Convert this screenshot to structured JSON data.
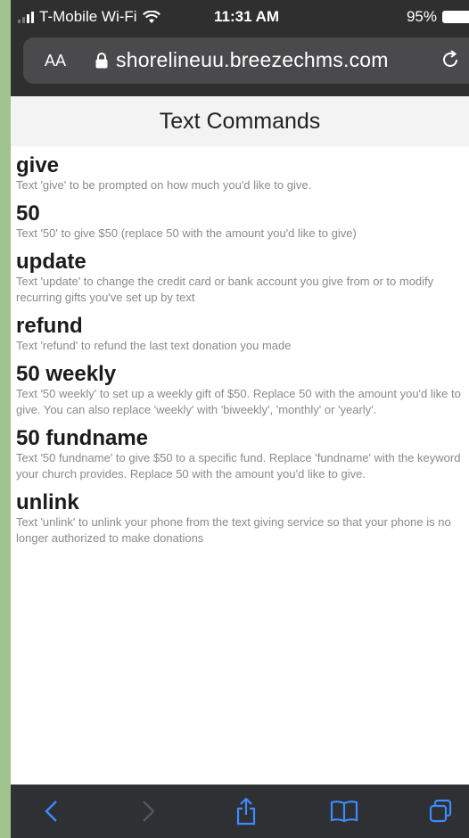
{
  "status_bar": {
    "carrier": "T-Mobile Wi-Fi",
    "time": "11:31 AM",
    "battery": "95%"
  },
  "browser": {
    "text_size_label": "AA",
    "url": "shorelineuu.breezechms.com"
  },
  "page": {
    "title": "Text Commands",
    "commands": [
      {
        "keyword": "give",
        "description": "Text 'give' to be prompted on how much you'd like to give."
      },
      {
        "keyword": "50",
        "description": "Text '50' to give $50 (replace 50 with the amount you'd like to give)"
      },
      {
        "keyword": "update",
        "description": "Text 'update' to change the credit card or bank account you give from or to modify recurring gifts you've set up by text"
      },
      {
        "keyword": "refund",
        "description": "Text 'refund' to refund the last text donation you made"
      },
      {
        "keyword": "50 weekly",
        "description": "Text '50 weekly' to set up a weekly gift of $50. Replace 50 with the amount you'd like to give. You can also replace 'weekly' with 'biweekly', 'monthly' or 'yearly'."
      },
      {
        "keyword": "50 fundname",
        "description": "Text '50 fundname' to give $50 to a specific fund. Replace 'fundname' with the keyword your church provides. Replace 50 with the amount you'd like to give."
      },
      {
        "keyword": "unlink",
        "description": "Text 'unlink' to unlink your phone from the text giving service so that your phone is no longer authorized to make donations"
      }
    ]
  },
  "toolbar": {
    "icons": [
      "back-icon",
      "forward-icon",
      "share-icon",
      "bookmarks-icon",
      "tabs-icon"
    ]
  },
  "colors": {
    "chrome": "#2f2f30",
    "address_bar": "#4a4a4c",
    "toolbar": "#2e3033",
    "accent": "#3d8bff",
    "desc_text": "#8a8a8a"
  }
}
